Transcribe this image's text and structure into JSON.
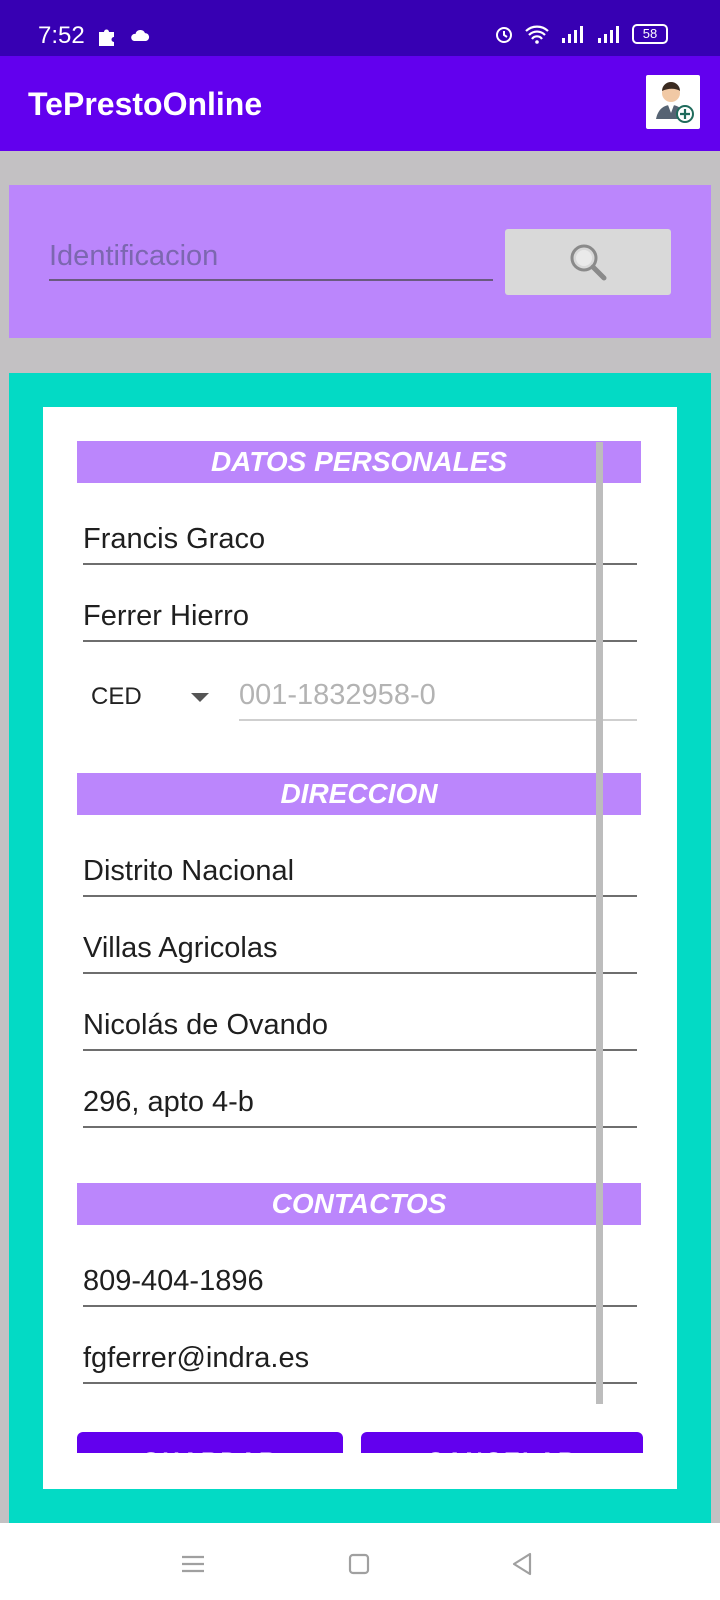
{
  "status_bar": {
    "time": "7:52",
    "battery": "58",
    "icons": [
      "puzzle-icon",
      "cloud-icon",
      "alarm-icon",
      "wifi-icon",
      "signal-icon",
      "signal-icon",
      "battery-icon"
    ]
  },
  "app_bar": {
    "title": "TePrestoOnline",
    "action_icon": "add-user-icon"
  },
  "search": {
    "placeholder": "Identificacion",
    "button_icon": "search-icon"
  },
  "sections": {
    "personal": {
      "title": "DATOS PERSONALES",
      "first_name": "Francis Graco",
      "last_name": "Ferrer Hierro",
      "doc_type": "CED",
      "doc_number_hint": "001-1832958-0"
    },
    "address": {
      "title": "DIRECCION",
      "province": "Distrito Nacional",
      "sector": "Villas Agricolas",
      "street": "Nicolás de Ovando",
      "number": "296, apto 4-b"
    },
    "contacts": {
      "title": "CONTACTOS",
      "phone": "809-404-1896",
      "email": "fgferrer@indra.es"
    }
  },
  "actions": {
    "save_label": "GUARDAR",
    "cancel_label": "CANCELAR"
  },
  "nav_bar": {
    "icons": [
      "menu-icon",
      "home-icon",
      "back-icon"
    ]
  },
  "colors": {
    "status_bar": "#3700b3",
    "primary": "#6200ee",
    "accent": "#bb86fc",
    "panel": "#03dac5",
    "background": "#c3c1c3"
  }
}
